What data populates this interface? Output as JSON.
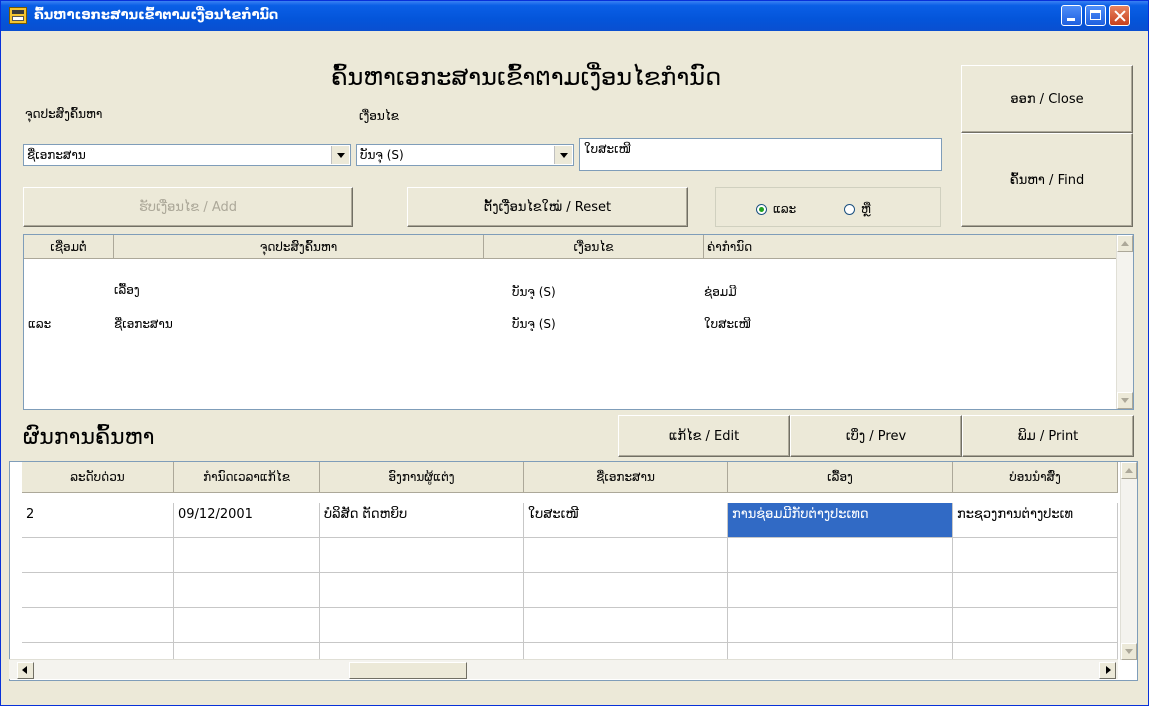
{
  "window": {
    "title": "ຄົ້ນຫາເອກະສານເຂົ້າຕາມເງື່ອນໄຂກຳນົດ"
  },
  "form": {
    "heading": "ຄົ້ນຫາເອກະສານເຂົ້າຕາມເງື່ອນໄຂກຳນົດ",
    "field_label": "ຈຸດປະສົງຄົ້ນຫາ",
    "condition_label": "ເງື່ອນໄຂ",
    "field_value": "ຊື່ເອກະສານ",
    "condition_value": "ບັນຈຸ (S)",
    "search_value": "ໃບສະເໜີ",
    "add_label": "ຮັບເງື່ອນໄຂ / Add",
    "reset_label": "ຕັ້ງເງື່ອນໄຂໃໝ່ / Reset",
    "and_label": "ແລະ",
    "or_label": "ຫຼື",
    "close_label": "ອອກ / Close",
    "find_label": "ຄົ້ນຫາ / Find"
  },
  "criteria": {
    "headers": [
      "ເຊື່ອມຕໍ່",
      "ຈຸດປະສົງຄົ້ນຫາ",
      "ເງື່ອນໄຂ",
      "ຄ່າກຳນົດ"
    ],
    "rows": [
      {
        "join": "",
        "field": "ເລື້ອງ",
        "cond": "ບັນຈຸ (S)",
        "value": "ຊ່ອມມີ"
      },
      {
        "join": "ແລະ",
        "field": "ຊື່ເອກະສານ",
        "cond": "ບັນຈຸ (S)",
        "value": "ໃບສະເໜີ"
      }
    ]
  },
  "results": {
    "title": "ຜົນການຄົ້ນຫາ",
    "edit_label": "ແກ້ໄຂ / Edit",
    "prev_label": "ເບິ່ງ / Prev",
    "print_label": "ພິມ / Print",
    "headers": [
      "ລະດັບດ່ວນ",
      "ກຳນົດເວລາແກ້ໄຂ",
      "ອົງການຜູ້ແຕ່ງ",
      "ຊື່ເອກະສານ",
      "ເລື້ອງ",
      "ບ່ອນນຳສົ່ງ"
    ],
    "rows": [
      [
        "2",
        "09/12/2001",
        "ບໍລິສັດ ຕັດຫຍິບ",
        "ໃບສະເໜີ",
        "ການຊ່ອມມີກັບຕ່າງປະເທດ",
        "ກະຊວງການຕ່າງປະເທ"
      ]
    ]
  }
}
